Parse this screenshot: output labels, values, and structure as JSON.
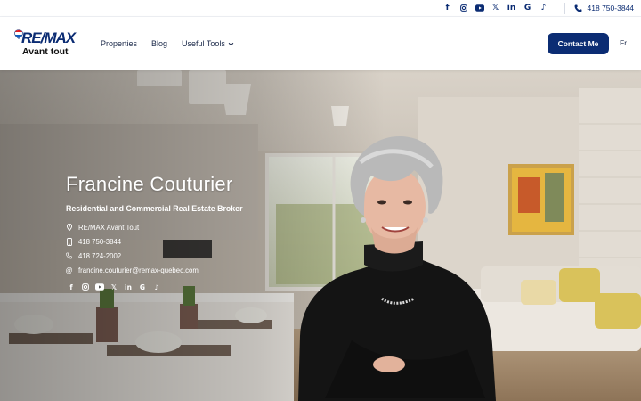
{
  "topbar": {
    "social_icons": [
      "facebook-icon",
      "instagram-icon",
      "youtube-icon",
      "x-icon",
      "linkedin-icon",
      "google-icon",
      "tiktok-icon"
    ],
    "phone": "418 750-3844"
  },
  "header": {
    "logo_brand": "RE/MAX",
    "logo_sub": "Avant tout",
    "nav": [
      {
        "label": "Properties"
      },
      {
        "label": "Blog"
      },
      {
        "label": "Useful Tools"
      }
    ],
    "contact_label": "Contact Me",
    "lang_label": "Fr"
  },
  "hero": {
    "name": "Francine Couturier",
    "role": "Residential and Commercial Real Estate Broker",
    "agency": "RE/MAX Avant Tout",
    "mobile": "418 750-3844",
    "phone": "418 724-2002",
    "email": "francine.couturier@remax-quebec.com",
    "social_icons": [
      "facebook-icon",
      "instagram-icon",
      "youtube-icon",
      "x-icon",
      "linkedin-icon",
      "google-icon",
      "tiktok-icon"
    ]
  },
  "colors": {
    "brand_navy": "#0b2c73",
    "brand_red": "#e11b22"
  }
}
